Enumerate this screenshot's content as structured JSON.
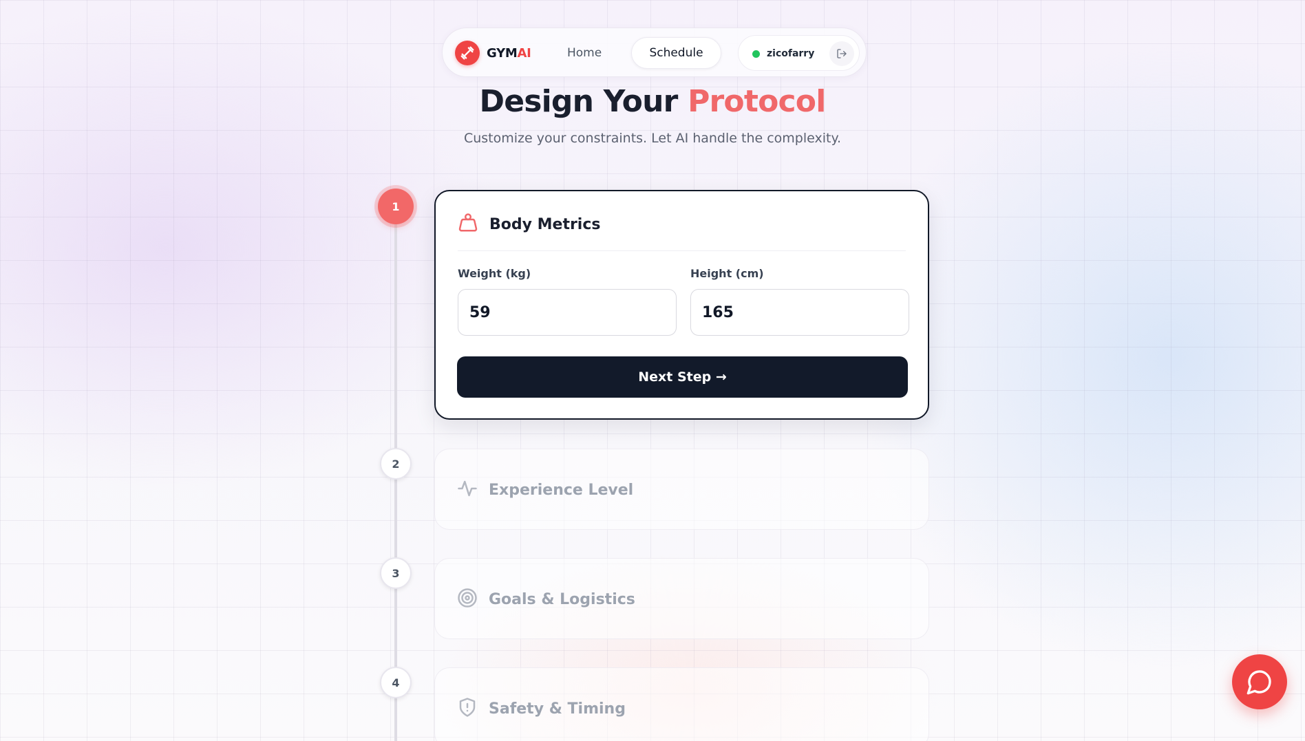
{
  "app": {
    "logo_text_main": "GYM",
    "logo_text_accent": "AI"
  },
  "nav": {
    "home": "Home",
    "schedule": "Schedule",
    "username": "zicofarry",
    "status_color": "#22c55e"
  },
  "hero": {
    "title_main": "Design Your ",
    "title_accent": "Protocol",
    "subtitle": "Customize your constraints. Let AI handle the complexity."
  },
  "steps": [
    {
      "number": "1",
      "title": "Body Metrics",
      "icon": "weight-icon",
      "active": true,
      "fields": [
        {
          "label": "Weight (kg)",
          "value": "59"
        },
        {
          "label": "Height (cm)",
          "value": "165"
        }
      ],
      "button_label": "Next Step →"
    },
    {
      "number": "2",
      "title": "Experience Level",
      "icon": "activity-icon",
      "active": false
    },
    {
      "number": "3",
      "title": "Goals & Logistics",
      "icon": "target-icon",
      "active": false
    },
    {
      "number": "4",
      "title": "Safety & Timing",
      "icon": "shield-icon",
      "active": false
    }
  ],
  "colors": {
    "accent": "#f0686a",
    "brand_red": "#ef4444",
    "dark_button": "#121a2a"
  }
}
